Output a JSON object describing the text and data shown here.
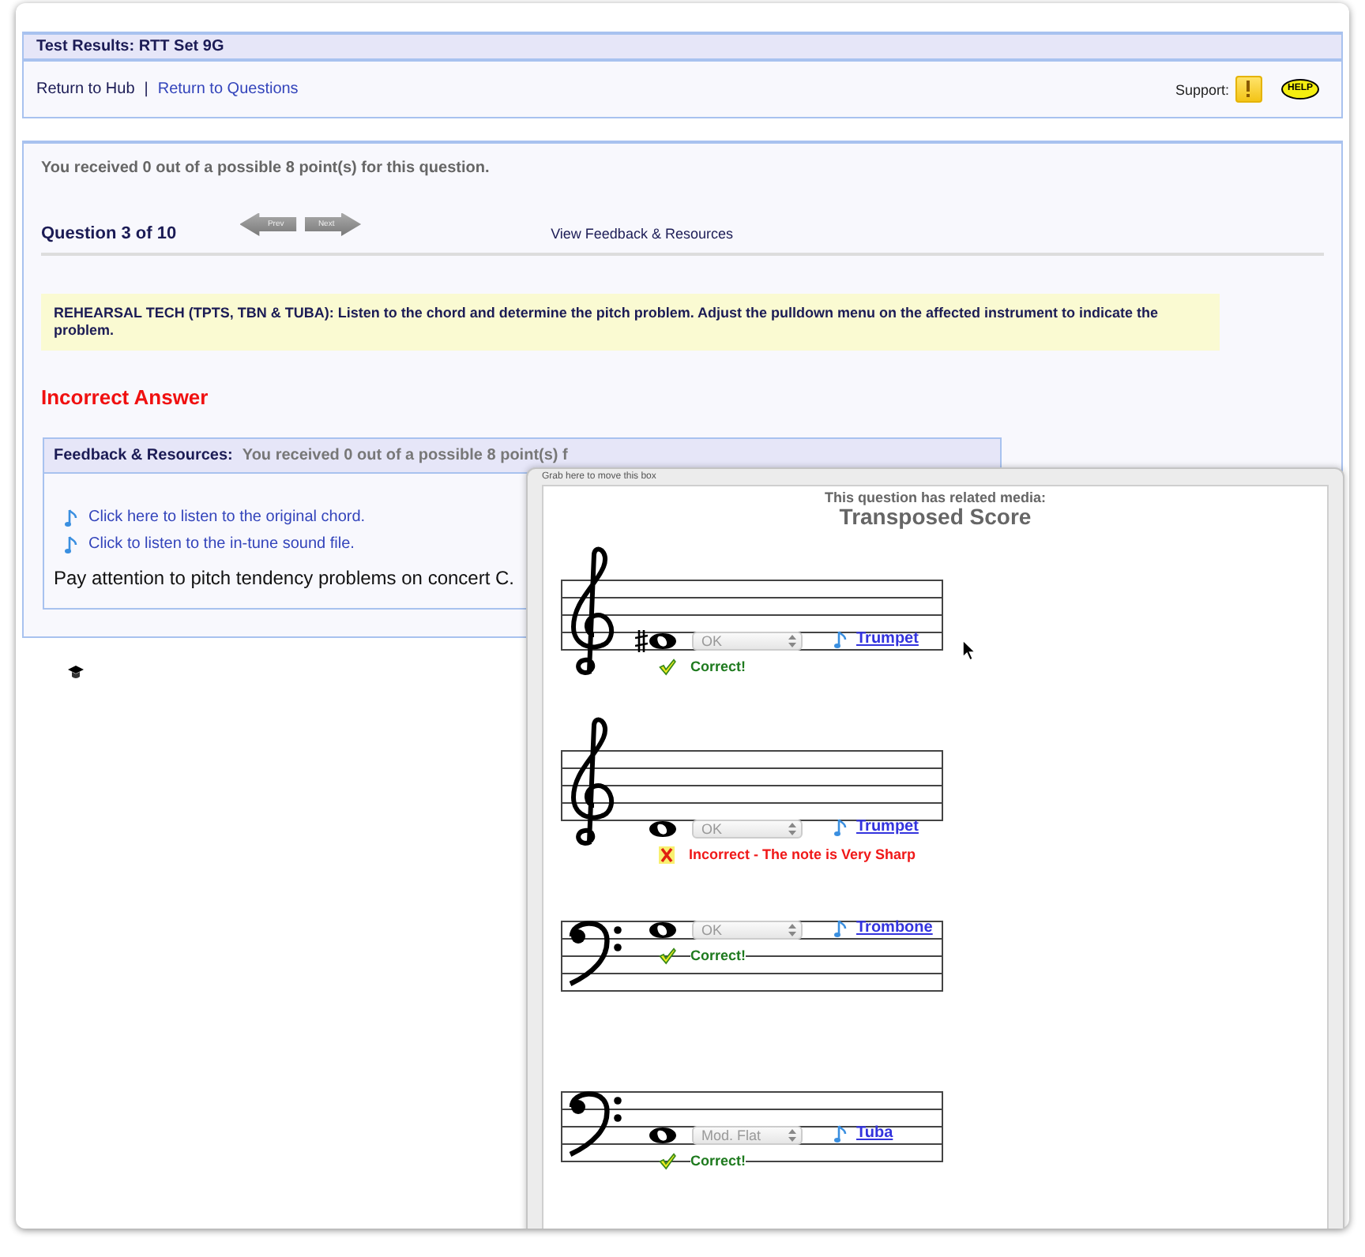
{
  "header": {
    "title": "Test Results: RTT Set 9G"
  },
  "nav": {
    "links": [
      "Return to Hub",
      "Return to Questions"
    ],
    "separator": "|",
    "support_label": "Support:",
    "help_label": "HELP"
  },
  "score": "You received 0 out of a possible 8 point(s) for this question.",
  "question": {
    "label": "Question 3 of 10",
    "prev": "Prev",
    "next": "Next",
    "feedback_link": "View Feedback & Resources"
  },
  "prompt": "REHEARSAL TECH (TPTS, TBN & TUBA): Listen to the chord and determine the pitch problem. Adjust the pulldown menu on the affected instrument to indicate the problem.",
  "result": "Incorrect Answer",
  "feedback": {
    "title": "Feedback & Resources:",
    "summary": "You received 0 out of a possible 8 point(s) f",
    "links": [
      "Click here to listen to the original chord.",
      "Click to listen to the in-tune sound file."
    ],
    "note": "Pay attention to pitch tendency problems on concert C."
  },
  "media": {
    "grab": "Grab here to move this box",
    "intro": "This question has related media:",
    "title": "Transposed Score",
    "staves": [
      {
        "kind": "treble",
        "sharp": true,
        "answer": "OK",
        "instrument": "Trumpet",
        "correct": true,
        "message": "Correct!"
      },
      {
        "kind": "treble",
        "sharp": false,
        "answer": "OK",
        "instrument": "Trumpet",
        "correct": false,
        "message": "Incorrect - The note is Very Sharp"
      },
      {
        "kind": "bass",
        "sharp": false,
        "answer": "OK",
        "instrument": "Trombone",
        "correct": true,
        "message": "Correct!"
      },
      {
        "kind": "bass",
        "sharp": false,
        "answer": "Mod. Flat",
        "instrument": "Tuba",
        "correct": true,
        "message": "Correct!"
      }
    ]
  }
}
